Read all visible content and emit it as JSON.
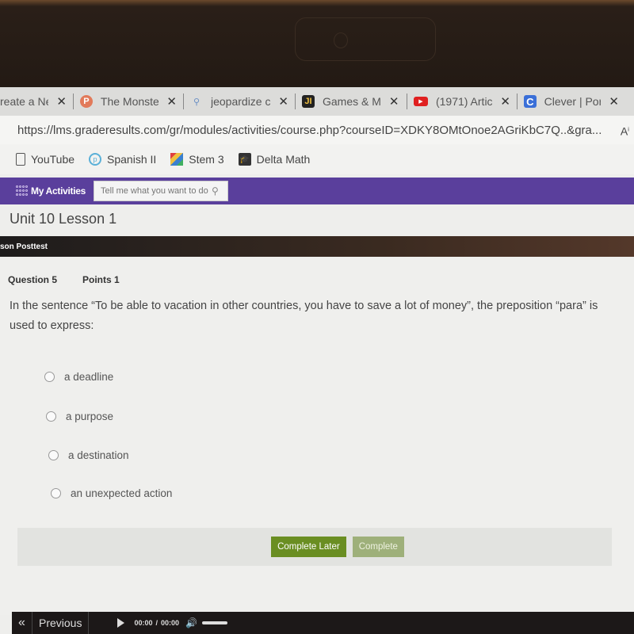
{
  "browser": {
    "tabs": [
      {
        "icon": "edit-icon",
        "title": "reate a Ne"
      },
      {
        "icon": "powerpoint-icon",
        "title": "The Monste"
      },
      {
        "icon": "search-icon",
        "title": "jeopardize c"
      },
      {
        "icon": "jl-icon",
        "title": "Games & M"
      },
      {
        "icon": "youtube-icon",
        "title": "(1971) Artic"
      },
      {
        "icon": "clever-icon",
        "title": "Clever | Por"
      }
    ],
    "url": "https://lms.graderesults.com/gr/modules/activities/course.php?courseID=XDKY8OMtOnoe2AGriKbC7Q..&gra...",
    "bookmarks": [
      {
        "icon": "page-icon",
        "label": "YouTube"
      },
      {
        "icon": "spanish-icon",
        "label": "Spanish II"
      },
      {
        "icon": "stem-icon",
        "label": "Stem 3"
      },
      {
        "icon": "delta-math-icon",
        "label": "Delta Math"
      }
    ]
  },
  "app": {
    "nav_label": "My Activities",
    "search_placeholder": "Tell me what you want to do",
    "unit_title": "Unit 10 Lesson 1",
    "section_title": "son Posttest"
  },
  "question": {
    "number_label": "Question 5",
    "points_label": "Points 1",
    "text": "In the sentence “To be able to vacation in other countries, you have to save a lot of money”, the preposition “para” is used to express:",
    "choices": [
      "a deadline",
      "a purpose",
      "a destination",
      "an unexpected action"
    ],
    "selected": null
  },
  "actions": {
    "complete_later": "Complete Later",
    "complete": "Complete"
  },
  "footer": {
    "prev_arrow": "«",
    "previous": "Previous",
    "time_current": "00:00",
    "time_total": "00:00"
  },
  "colors": {
    "app_header": "#5a3f9c",
    "complete_later": "#6a8e22",
    "complete": "#9eb07a"
  }
}
